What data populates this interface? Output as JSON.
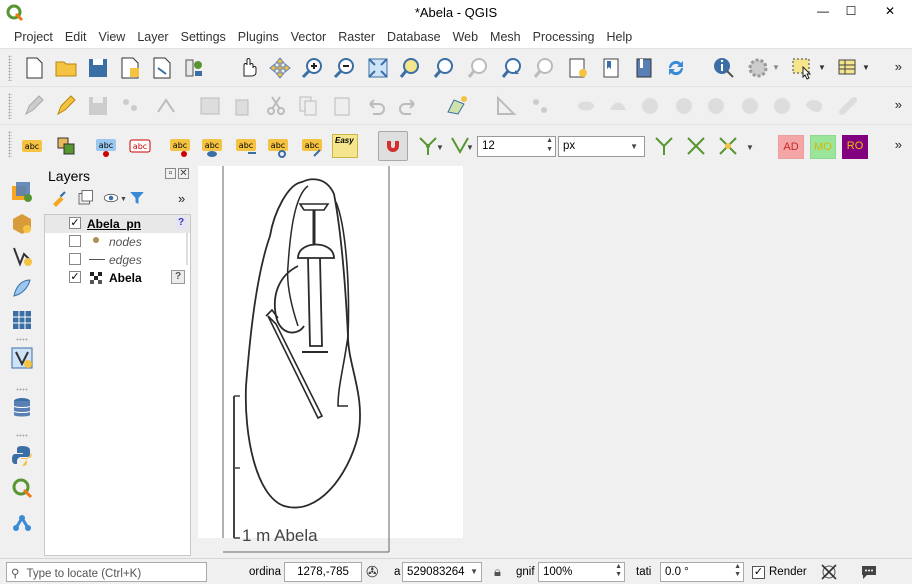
{
  "window": {
    "title": "*Abela - QGIS",
    "minimize": "—",
    "maximize": "☐",
    "close": "✕"
  },
  "menu": [
    "Project",
    "Edit",
    "View",
    "Layer",
    "Settings",
    "Plugins",
    "Vector",
    "Raster",
    "Database",
    "Web",
    "Mesh",
    "Processing",
    "Help"
  ],
  "label_toolbar": {
    "snap_tolerance": "12",
    "snap_unit": "px",
    "btn_ad": "AD",
    "btn_mo": "MO",
    "btn_ro": "RO",
    "easy_label": "Easy"
  },
  "layers_panel": {
    "title": "Layers",
    "items": [
      {
        "name": "Abela_pn",
        "checked": true,
        "style": "bold-underline"
      },
      {
        "name": "nodes",
        "checked": false,
        "style": "italic"
      },
      {
        "name": "edges",
        "checked": false,
        "style": "italic"
      },
      {
        "name": "Abela",
        "checked": true,
        "style": "bold"
      }
    ]
  },
  "map": {
    "scale_text": "1 m  Abela"
  },
  "status": {
    "locate_placeholder": "Type to locate (Ctrl+K)",
    "coord_label": "ordina",
    "coord_value": "1278,-785",
    "scale_label": "a",
    "scale_value": "529083264",
    "magnifier_label": "gnif",
    "magnifier_value": "100%",
    "rotation_label": "tati",
    "rotation_value": "0.0 °",
    "render_label": "Render"
  },
  "colors": {
    "accent": "#589632",
    "ad_bg": "#f4a5a5",
    "mo_bg": "#9be59b",
    "ro_bg": "#800080"
  }
}
